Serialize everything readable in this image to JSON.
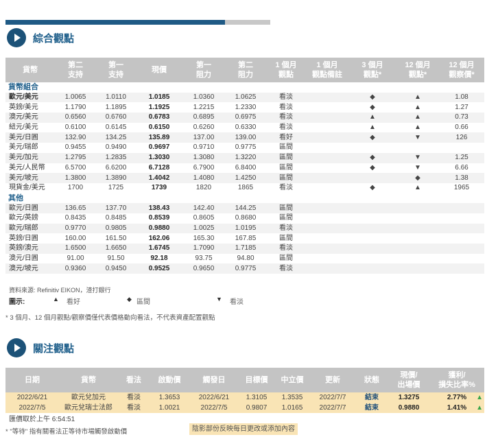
{
  "progress": {
    "fraction": 0.83
  },
  "section1": {
    "title": "綜合觀點",
    "headers": [
      "貨幣",
      "第二\n支持",
      "第一\n支持",
      "現價",
      "第一\n阻力",
      "第二\n阻力",
      "1 個月\n觀點",
      "1 個月\n觀點備註",
      "3 個月\n觀點*",
      "12 個月\n觀點*",
      "12 個月\n觀察價*"
    ],
    "groups": [
      {
        "name": "貨幣組合",
        "rows": [
          {
            "pair": "歐元/美元",
            "s2": "1.0065",
            "s1": "1.0110",
            "cur": "1.0185",
            "r1": "1.0360",
            "r2": "1.0625",
            "v1m": "看淡",
            "c1m": "bear",
            "note": "",
            "v3m": "◆",
            "v12m": "▲",
            "p12": "1.08",
            "bold": true
          },
          {
            "pair": "英鎊/美元",
            "s2": "1.1790",
            "s1": "1.1895",
            "cur": "1.1925",
            "r1": "1.2215",
            "r2": "1.2330",
            "v1m": "看淡",
            "c1m": "bear",
            "note": "",
            "v3m": "◆",
            "v12m": "▲",
            "p12": "1.27",
            "bold": false
          },
          {
            "pair": "澳元/美元",
            "s2": "0.6560",
            "s1": "0.6760",
            "cur": "0.6783",
            "r1": "0.6895",
            "r2": "0.6975",
            "v1m": "看淡",
            "c1m": "bear",
            "note": "",
            "v3m": "▲",
            "v12m": "▲",
            "p12": "0.73",
            "bold": false
          },
          {
            "pair": "紐元/美元",
            "s2": "0.6100",
            "s1": "0.6145",
            "cur": "0.6150",
            "r1": "0.6260",
            "r2": "0.6330",
            "v1m": "看淡",
            "c1m": "bear",
            "note": "",
            "v3m": "▲",
            "v12m": "▲",
            "p12": "0.66",
            "bold": false
          },
          {
            "pair": "美元/日圓",
            "s2": "132.90",
            "s1": "134.25",
            "cur": "135.89",
            "r1": "137.00",
            "r2": "139.00",
            "v1m": "看好",
            "c1m": "bull",
            "note": "",
            "v3m": "◆",
            "v12m": "▼",
            "p12": "126",
            "bold": false
          },
          {
            "pair": "美元/瑞郎",
            "s2": "0.9455",
            "s1": "0.9490",
            "cur": "0.9697",
            "r1": "0.9710",
            "r2": "0.9775",
            "v1m": "區間",
            "c1m": "neut",
            "note": "",
            "v3m": "",
            "v12m": "",
            "p12": "",
            "bold": false
          },
          {
            "pair": "美元/加元",
            "s2": "1.2795",
            "s1": "1.2835",
            "cur": "1.3030",
            "r1": "1.3080",
            "r2": "1.3220",
            "v1m": "區間",
            "c1m": "neut",
            "note": "",
            "v3m": "◆",
            "v12m": "▼",
            "p12": "1.25",
            "bold": false
          },
          {
            "pair": "美元/人民幣",
            "s2": "6.5700",
            "s1": "6.6200",
            "cur": "6.7128",
            "r1": "6.7900",
            "r2": "6.8400",
            "v1m": "區間",
            "c1m": "neut",
            "note": "",
            "v3m": "◆",
            "v12m": "▼",
            "p12": "6.66",
            "bold": false
          },
          {
            "pair": "美元/坡元",
            "s2": "1.3800",
            "s1": "1.3890",
            "cur": "1.4042",
            "r1": "1.4080",
            "r2": "1.4250",
            "v1m": "區間",
            "c1m": "neut",
            "note": "",
            "v3m": "",
            "v12m": "◆",
            "p12": "1.38",
            "bold": false
          },
          {
            "pair": "現貨金/美元",
            "s2": "1700",
            "s1": "1725",
            "cur": "1739",
            "r1": "1820",
            "r2": "1865",
            "v1m": "看淡",
            "c1m": "bear",
            "note": "",
            "v3m": "◆",
            "v12m": "▲",
            "p12": "1965",
            "bold": false
          }
        ]
      },
      {
        "name": "其他",
        "rows": [
          {
            "pair": "歐元/日圓",
            "s2": "136.65",
            "s1": "137.70",
            "cur": "138.43",
            "r1": "142.40",
            "r2": "144.25",
            "v1m": "區間",
            "c1m": "neut",
            "note": "",
            "v3m": "",
            "v12m": "",
            "p12": "",
            "bold": false
          },
          {
            "pair": "歐元/英鎊",
            "s2": "0.8435",
            "s1": "0.8485",
            "cur": "0.8539",
            "r1": "0.8605",
            "r2": "0.8680",
            "v1m": "區間",
            "c1m": "neut",
            "note": "",
            "v3m": "",
            "v12m": "",
            "p12": "",
            "bold": false
          },
          {
            "pair": "歐元/瑞郎",
            "s2": "0.9770",
            "s1": "0.9805",
            "cur": "0.9880",
            "r1": "1.0025",
            "r2": "1.0195",
            "v1m": "看淡",
            "c1m": "bear",
            "note": "",
            "v3m": "",
            "v12m": "",
            "p12": "",
            "bold": false
          },
          {
            "pair": "英鎊/日圓",
            "s2": "160.00",
            "s1": "161.50",
            "cur": "162.06",
            "r1": "165.30",
            "r2": "167.85",
            "v1m": "區間",
            "c1m": "neut",
            "note": "",
            "v3m": "",
            "v12m": "",
            "p12": "",
            "bold": false
          },
          {
            "pair": "英鎊/澳元",
            "s2": "1.6500",
            "s1": "1.6650",
            "cur": "1.6745",
            "r1": "1.7090",
            "r2": "1.7185",
            "v1m": "看淡",
            "c1m": "bear",
            "note": "",
            "v3m": "",
            "v12m": "",
            "p12": "",
            "bold": false
          },
          {
            "pair": "澳元/日圓",
            "s2": "91.00",
            "s1": "91.50",
            "cur": "92.18",
            "r1": "93.75",
            "r2": "94.80",
            "v1m": "區間",
            "c1m": "neut",
            "note": "",
            "v3m": "",
            "v12m": "",
            "p12": "",
            "bold": false
          },
          {
            "pair": "澳元/坡元",
            "s2": "0.9360",
            "s1": "0.9450",
            "cur": "0.9525",
            "r1": "0.9650",
            "r2": "0.9775",
            "v1m": "看淡",
            "c1m": "bear",
            "note": "",
            "v3m": "",
            "v12m": "",
            "p12": "",
            "bold": false
          }
        ]
      }
    ],
    "source": "資料來源: Refinitiv EIKON，渣打銀行",
    "legend": {
      "label": "圖示:",
      "bull_sym": "▲",
      "bull_text": "看好",
      "neut_sym": "◆",
      "neut_text": "區間",
      "bear_sym": "▼",
      "bear_text": "看淡"
    },
    "footnote": "* 3 個月、12 個月觀點/觀察價僅代表價格動向看法，不代表資產配置觀點"
  },
  "section2": {
    "title": "關注觀點",
    "headers": [
      "日期",
      "貨幣",
      "看法",
      "啟動價",
      "觸發日",
      "目標價",
      "中立價",
      "更新",
      "狀態",
      "現價/\n出場價",
      "獲利/\n損失比率%"
    ],
    "rows": [
      {
        "date": "2022/6/21",
        "pair": "歐元兌加元",
        "view": "看淡",
        "entry": "1.3653",
        "trigger": "2022/6/21",
        "target": "1.3105",
        "neutral": "1.3535",
        "updated": "2022/7/7",
        "status": "結束",
        "exit": "1.3275",
        "pnl": "2.77%",
        "arrow": "▲"
      },
      {
        "date": "2022/7/5",
        "pair": "歐元兌瑞士法郎",
        "view": "看淡",
        "entry": "1.0021",
        "trigger": "2022/7/5",
        "target": "0.9807",
        "neutral": "1.0165",
        "updated": "2022/7/7",
        "status": "結束",
        "exit": "0.9880",
        "pnl": "1.41%",
        "arrow": "▲"
      }
    ],
    "price_time": "匯價取於上午 6:54:51",
    "wait_note": "* \"等待\" 指有關看法正等待市場觸發啟動價",
    "shade_note": "陰影部份反映每日更改或添加內容"
  },
  "colors": {
    "accent": "#1f5f8b",
    "bear": "#e23a2a",
    "bull": "#69b42d",
    "neutral": "#f0b43a",
    "highlight": "#f9e4b5"
  }
}
